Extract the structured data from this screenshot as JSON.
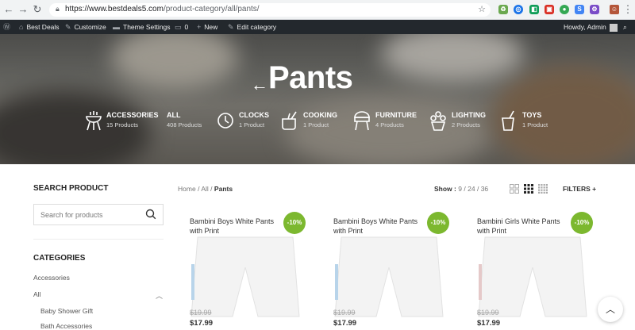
{
  "browser": {
    "url_domain": "https://www.bestdeals5.com",
    "url_path": "/product-category/all/pants/"
  },
  "admin_bar": {
    "site_name": "Best Deals",
    "customize": "Customize",
    "theme_settings": "Theme Settings",
    "comments_count": "0",
    "new_label": "New",
    "edit_category": "Edit category",
    "howdy": "Howdy, Admin"
  },
  "hero": {
    "title": "Pants",
    "back_arrow": "←",
    "categories": [
      {
        "name": "ACCESSORIES",
        "count": "15 Products",
        "icon": "bbq-grill-icon"
      },
      {
        "name": "ALL",
        "count": "408 Products",
        "icon": ""
      },
      {
        "name": "CLOCKS",
        "count": "1 Product",
        "icon": "clock-icon"
      },
      {
        "name": "COOKING",
        "count": "1 Product",
        "icon": "cooking-pot-icon"
      },
      {
        "name": "FURNITURE",
        "count": "4 Products",
        "icon": "grill-icon"
      },
      {
        "name": "LIGHTING",
        "count": "2 Products",
        "icon": "lamp-icon"
      },
      {
        "name": "TOYS",
        "count": "1 Product",
        "icon": "cup-icon"
      }
    ]
  },
  "sidebar": {
    "search_title": "SEARCH PRODUCT",
    "search_placeholder": "Search for products",
    "categories_title": "CATEGORIES",
    "links": [
      "Accessories",
      "All",
      "Baby Shower Gift",
      "Bath Accessories"
    ]
  },
  "toolbar": {
    "breadcrumb_home": "Home",
    "breadcrumb_all": "All",
    "breadcrumb_current": "Pants",
    "sep": "/",
    "show_label": "Show :",
    "show_options": [
      "9",
      "24",
      "36"
    ],
    "filters": "FILTERS"
  },
  "products": [
    {
      "name": "Bambini Boys White Pants with Print",
      "badge": "-10%",
      "old_price": "$19.99",
      "price": "$17.99"
    },
    {
      "name": "Bambini Boys White Pants with Print",
      "badge": "-10%",
      "old_price": "$19.99",
      "price": "$17.99"
    },
    {
      "name": "Bambini Girls White Pants with Print",
      "badge": "-10%",
      "old_price": "$19.99",
      "price": "$17.99"
    }
  ],
  "colors": {
    "accent_green": "#7cb82f",
    "admin_bar": "#23282d"
  }
}
